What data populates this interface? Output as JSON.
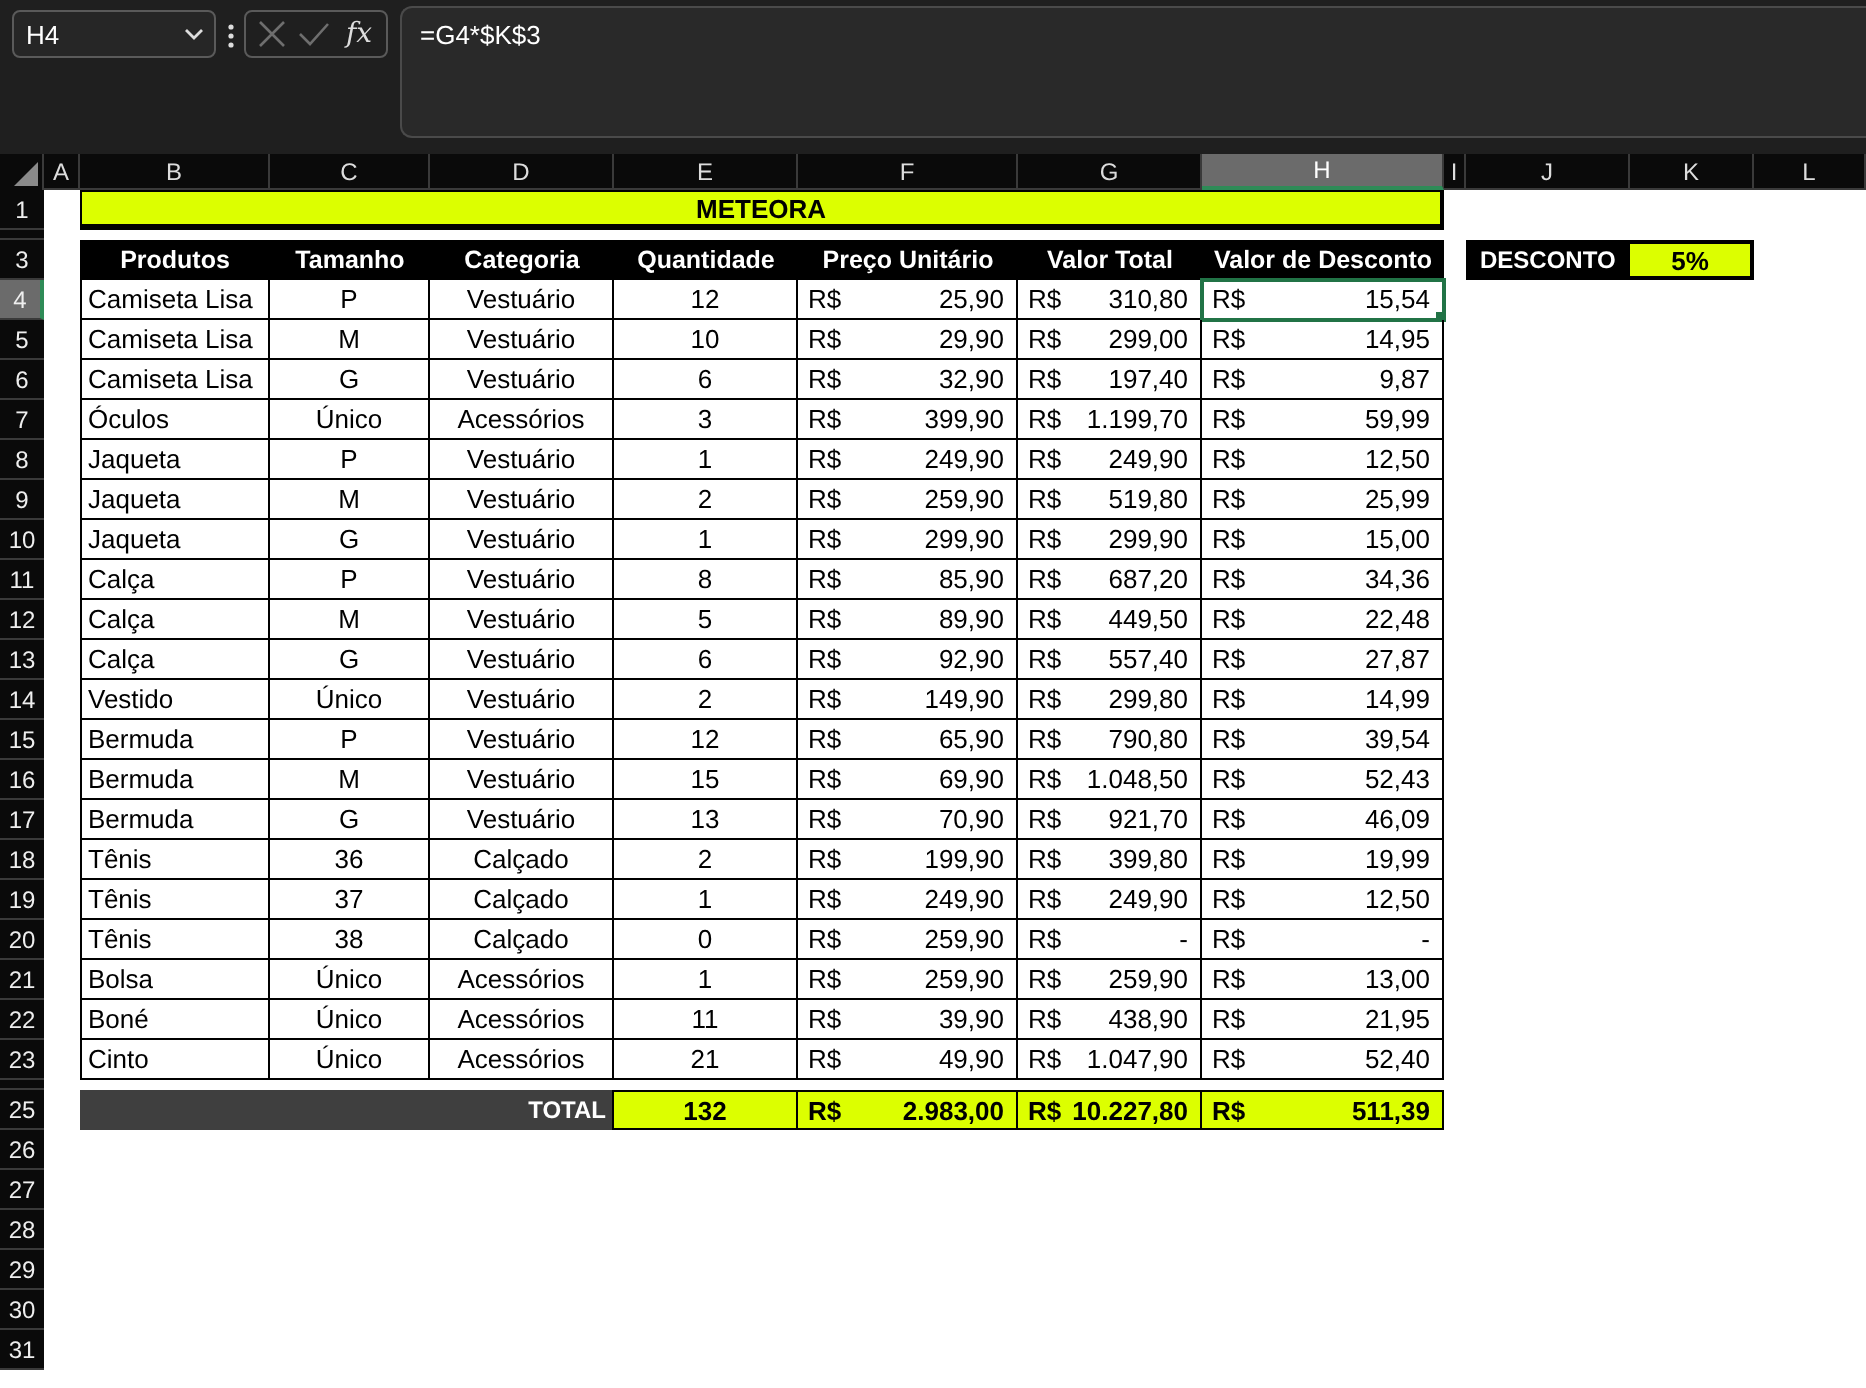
{
  "name_box": {
    "value": "H4"
  },
  "formula_bar": {
    "function_label": "fx",
    "value": "=G4*$K$3"
  },
  "column_headers": [
    {
      "label": "A",
      "selected": false
    },
    {
      "label": "B",
      "selected": false
    },
    {
      "label": "C",
      "selected": false
    },
    {
      "label": "D",
      "selected": false
    },
    {
      "label": "E",
      "selected": false
    },
    {
      "label": "F",
      "selected": false
    },
    {
      "label": "G",
      "selected": false
    },
    {
      "label": "H",
      "selected": true
    },
    {
      "label": "I",
      "selected": false
    },
    {
      "label": "J",
      "selected": false
    },
    {
      "label": "K",
      "selected": false
    },
    {
      "label": "L",
      "selected": false
    }
  ],
  "row_headers": [
    {
      "label": "1",
      "selected": false
    },
    {
      "label": "3",
      "selected": false
    },
    {
      "label": "4",
      "selected": true
    },
    {
      "label": "5",
      "selected": false
    },
    {
      "label": "6",
      "selected": false
    },
    {
      "label": "7",
      "selected": false
    },
    {
      "label": "8",
      "selected": false
    },
    {
      "label": "9",
      "selected": false
    },
    {
      "label": "10",
      "selected": false
    },
    {
      "label": "11",
      "selected": false
    },
    {
      "label": "12",
      "selected": false
    },
    {
      "label": "13",
      "selected": false
    },
    {
      "label": "14",
      "selected": false
    },
    {
      "label": "15",
      "selected": false
    },
    {
      "label": "16",
      "selected": false
    },
    {
      "label": "17",
      "selected": false
    },
    {
      "label": "18",
      "selected": false
    },
    {
      "label": "19",
      "selected": false
    },
    {
      "label": "20",
      "selected": false
    },
    {
      "label": "21",
      "selected": false
    },
    {
      "label": "22",
      "selected": false
    },
    {
      "label": "23",
      "selected": false
    },
    {
      "label": "25",
      "selected": false
    },
    {
      "label": "26",
      "selected": false
    },
    {
      "label": "27",
      "selected": false
    },
    {
      "label": "28",
      "selected": false
    },
    {
      "label": "29",
      "selected": false
    },
    {
      "label": "30",
      "selected": false
    },
    {
      "label": "31",
      "selected": false
    }
  ],
  "title": "METEORA",
  "table": {
    "columns": [
      "Produtos",
      "Tamanho",
      "Categoria",
      "Quantidade",
      "Preço Unitário",
      "Valor Total",
      "Valor de Desconto"
    ],
    "rows": [
      [
        "Camiseta Lisa",
        "P",
        "Vestuário",
        "12",
        {
          "currency": "R$",
          "amount": "25,90"
        },
        {
          "currency": "R$",
          "amount": "310,80"
        },
        {
          "currency": "R$",
          "amount": "15,54"
        }
      ],
      [
        "Camiseta Lisa",
        "M",
        "Vestuário",
        "10",
        {
          "currency": "R$",
          "amount": "29,90"
        },
        {
          "currency": "R$",
          "amount": "299,00"
        },
        {
          "currency": "R$",
          "amount": "14,95"
        }
      ],
      [
        "Camiseta Lisa",
        "G",
        "Vestuário",
        "6",
        {
          "currency": "R$",
          "amount": "32,90"
        },
        {
          "currency": "R$",
          "amount": "197,40"
        },
        {
          "currency": "R$",
          "amount": "9,87"
        }
      ],
      [
        "Óculos",
        "Único",
        "Acessórios",
        "3",
        {
          "currency": "R$",
          "amount": "399,90"
        },
        {
          "currency": "R$",
          "amount": "1.199,70"
        },
        {
          "currency": "R$",
          "amount": "59,99"
        }
      ],
      [
        "Jaqueta",
        "P",
        "Vestuário",
        "1",
        {
          "currency": "R$",
          "amount": "249,90"
        },
        {
          "currency": "R$",
          "amount": "249,90"
        },
        {
          "currency": "R$",
          "amount": "12,50"
        }
      ],
      [
        "Jaqueta",
        "M",
        "Vestuário",
        "2",
        {
          "currency": "R$",
          "amount": "259,90"
        },
        {
          "currency": "R$",
          "amount": "519,80"
        },
        {
          "currency": "R$",
          "amount": "25,99"
        }
      ],
      [
        "Jaqueta",
        "G",
        "Vestuário",
        "1",
        {
          "currency": "R$",
          "amount": "299,90"
        },
        {
          "currency": "R$",
          "amount": "299,90"
        },
        {
          "currency": "R$",
          "amount": "15,00"
        }
      ],
      [
        "Calça",
        "P",
        "Vestuário",
        "8",
        {
          "currency": "R$",
          "amount": "85,90"
        },
        {
          "currency": "R$",
          "amount": "687,20"
        },
        {
          "currency": "R$",
          "amount": "34,36"
        }
      ],
      [
        "Calça",
        "M",
        "Vestuário",
        "5",
        {
          "currency": "R$",
          "amount": "89,90"
        },
        {
          "currency": "R$",
          "amount": "449,50"
        },
        {
          "currency": "R$",
          "amount": "22,48"
        }
      ],
      [
        "Calça",
        "G",
        "Vestuário",
        "6",
        {
          "currency": "R$",
          "amount": "92,90"
        },
        {
          "currency": "R$",
          "amount": "557,40"
        },
        {
          "currency": "R$",
          "amount": "27,87"
        }
      ],
      [
        "Vestido",
        "Único",
        "Vestuário",
        "2",
        {
          "currency": "R$",
          "amount": "149,90"
        },
        {
          "currency": "R$",
          "amount": "299,80"
        },
        {
          "currency": "R$",
          "amount": "14,99"
        }
      ],
      [
        "Bermuda",
        "P",
        "Vestuário",
        "12",
        {
          "currency": "R$",
          "amount": "65,90"
        },
        {
          "currency": "R$",
          "amount": "790,80"
        },
        {
          "currency": "R$",
          "amount": "39,54"
        }
      ],
      [
        "Bermuda",
        "M",
        "Vestuário",
        "15",
        {
          "currency": "R$",
          "amount": "69,90"
        },
        {
          "currency": "R$",
          "amount": "1.048,50"
        },
        {
          "currency": "R$",
          "amount": "52,43"
        }
      ],
      [
        "Bermuda",
        "G",
        "Vestuário",
        "13",
        {
          "currency": "R$",
          "amount": "70,90"
        },
        {
          "currency": "R$",
          "amount": "921,70"
        },
        {
          "currency": "R$",
          "amount": "46,09"
        }
      ],
      [
        "Tênis",
        "36",
        "Calçado",
        "2",
        {
          "currency": "R$",
          "amount": "199,90"
        },
        {
          "currency": "R$",
          "amount": "399,80"
        },
        {
          "currency": "R$",
          "amount": "19,99"
        }
      ],
      [
        "Tênis",
        "37",
        "Calçado",
        "1",
        {
          "currency": "R$",
          "amount": "249,90"
        },
        {
          "currency": "R$",
          "amount": "249,90"
        },
        {
          "currency": "R$",
          "amount": "12,50"
        }
      ],
      [
        "Tênis",
        "38",
        "Calçado",
        "0",
        {
          "currency": "R$",
          "amount": "259,90"
        },
        {
          "currency": "R$",
          "amount": "-"
        },
        {
          "currency": "R$",
          "amount": "-"
        }
      ],
      [
        "Bolsa",
        "Único",
        "Acessórios",
        "1",
        {
          "currency": "R$",
          "amount": "259,90"
        },
        {
          "currency": "R$",
          "amount": "259,90"
        },
        {
          "currency": "R$",
          "amount": "13,00"
        }
      ],
      [
        "Boné",
        "Único",
        "Acessórios",
        "11",
        {
          "currency": "R$",
          "amount": "39,90"
        },
        {
          "currency": "R$",
          "amount": "438,90"
        },
        {
          "currency": "R$",
          "amount": "21,95"
        }
      ],
      [
        "Cinto",
        "Único",
        "Acessórios",
        "21",
        {
          "currency": "R$",
          "amount": "49,90"
        },
        {
          "currency": "R$",
          "amount": "1.047,90"
        },
        {
          "currency": "R$",
          "amount": "52,40"
        }
      ]
    ],
    "total": {
      "label": "TOTAL",
      "cells": [
        "132",
        {
          "currency": "R$",
          "amount": "2.983,00"
        },
        {
          "currency": "R$",
          "amount": "10.227,80"
        },
        {
          "currency": "R$",
          "amount": "511,39"
        }
      ]
    }
  },
  "discount": {
    "label": "DESCONTO",
    "value": "5%"
  }
}
